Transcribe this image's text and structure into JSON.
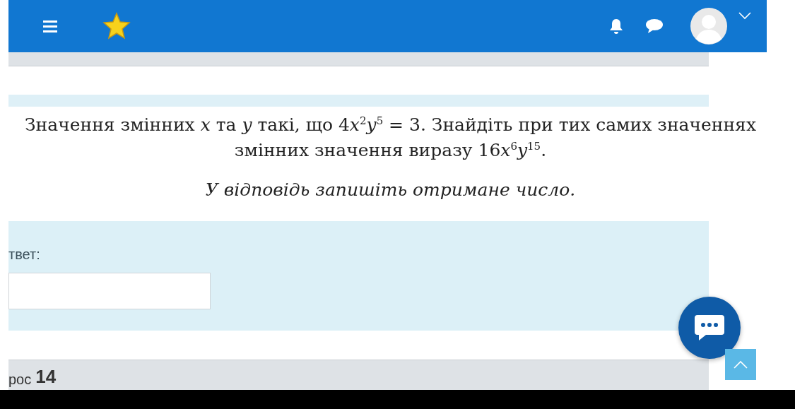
{
  "question": {
    "parts": [
      {
        "kind": "text",
        "text": "Значення змінних "
      },
      {
        "kind": "var",
        "text": "x"
      },
      {
        "kind": "text",
        "text": " та "
      },
      {
        "kind": "var",
        "text": "y"
      },
      {
        "kind": "text",
        "text": " такі, що 4"
      },
      {
        "kind": "var",
        "text": "x"
      },
      {
        "kind": "sup",
        "text": "2"
      },
      {
        "kind": "var",
        "text": "y"
      },
      {
        "kind": "sup",
        "text": "5"
      },
      {
        "kind": "text",
        "text": " = 3. Знайдіть при тих самих значеннях змінних значення виразу 16"
      },
      {
        "kind": "var",
        "text": "x"
      },
      {
        "kind": "sup",
        "text": "6"
      },
      {
        "kind": "var",
        "text": "y"
      },
      {
        "kind": "sup",
        "text": "15"
      },
      {
        "kind": "text",
        "text": "."
      }
    ],
    "instruction": "У відповідь запишіть отримане число."
  },
  "answer": {
    "label": "твет:"
  },
  "next_question": {
    "label": "рос",
    "number": "14"
  }
}
